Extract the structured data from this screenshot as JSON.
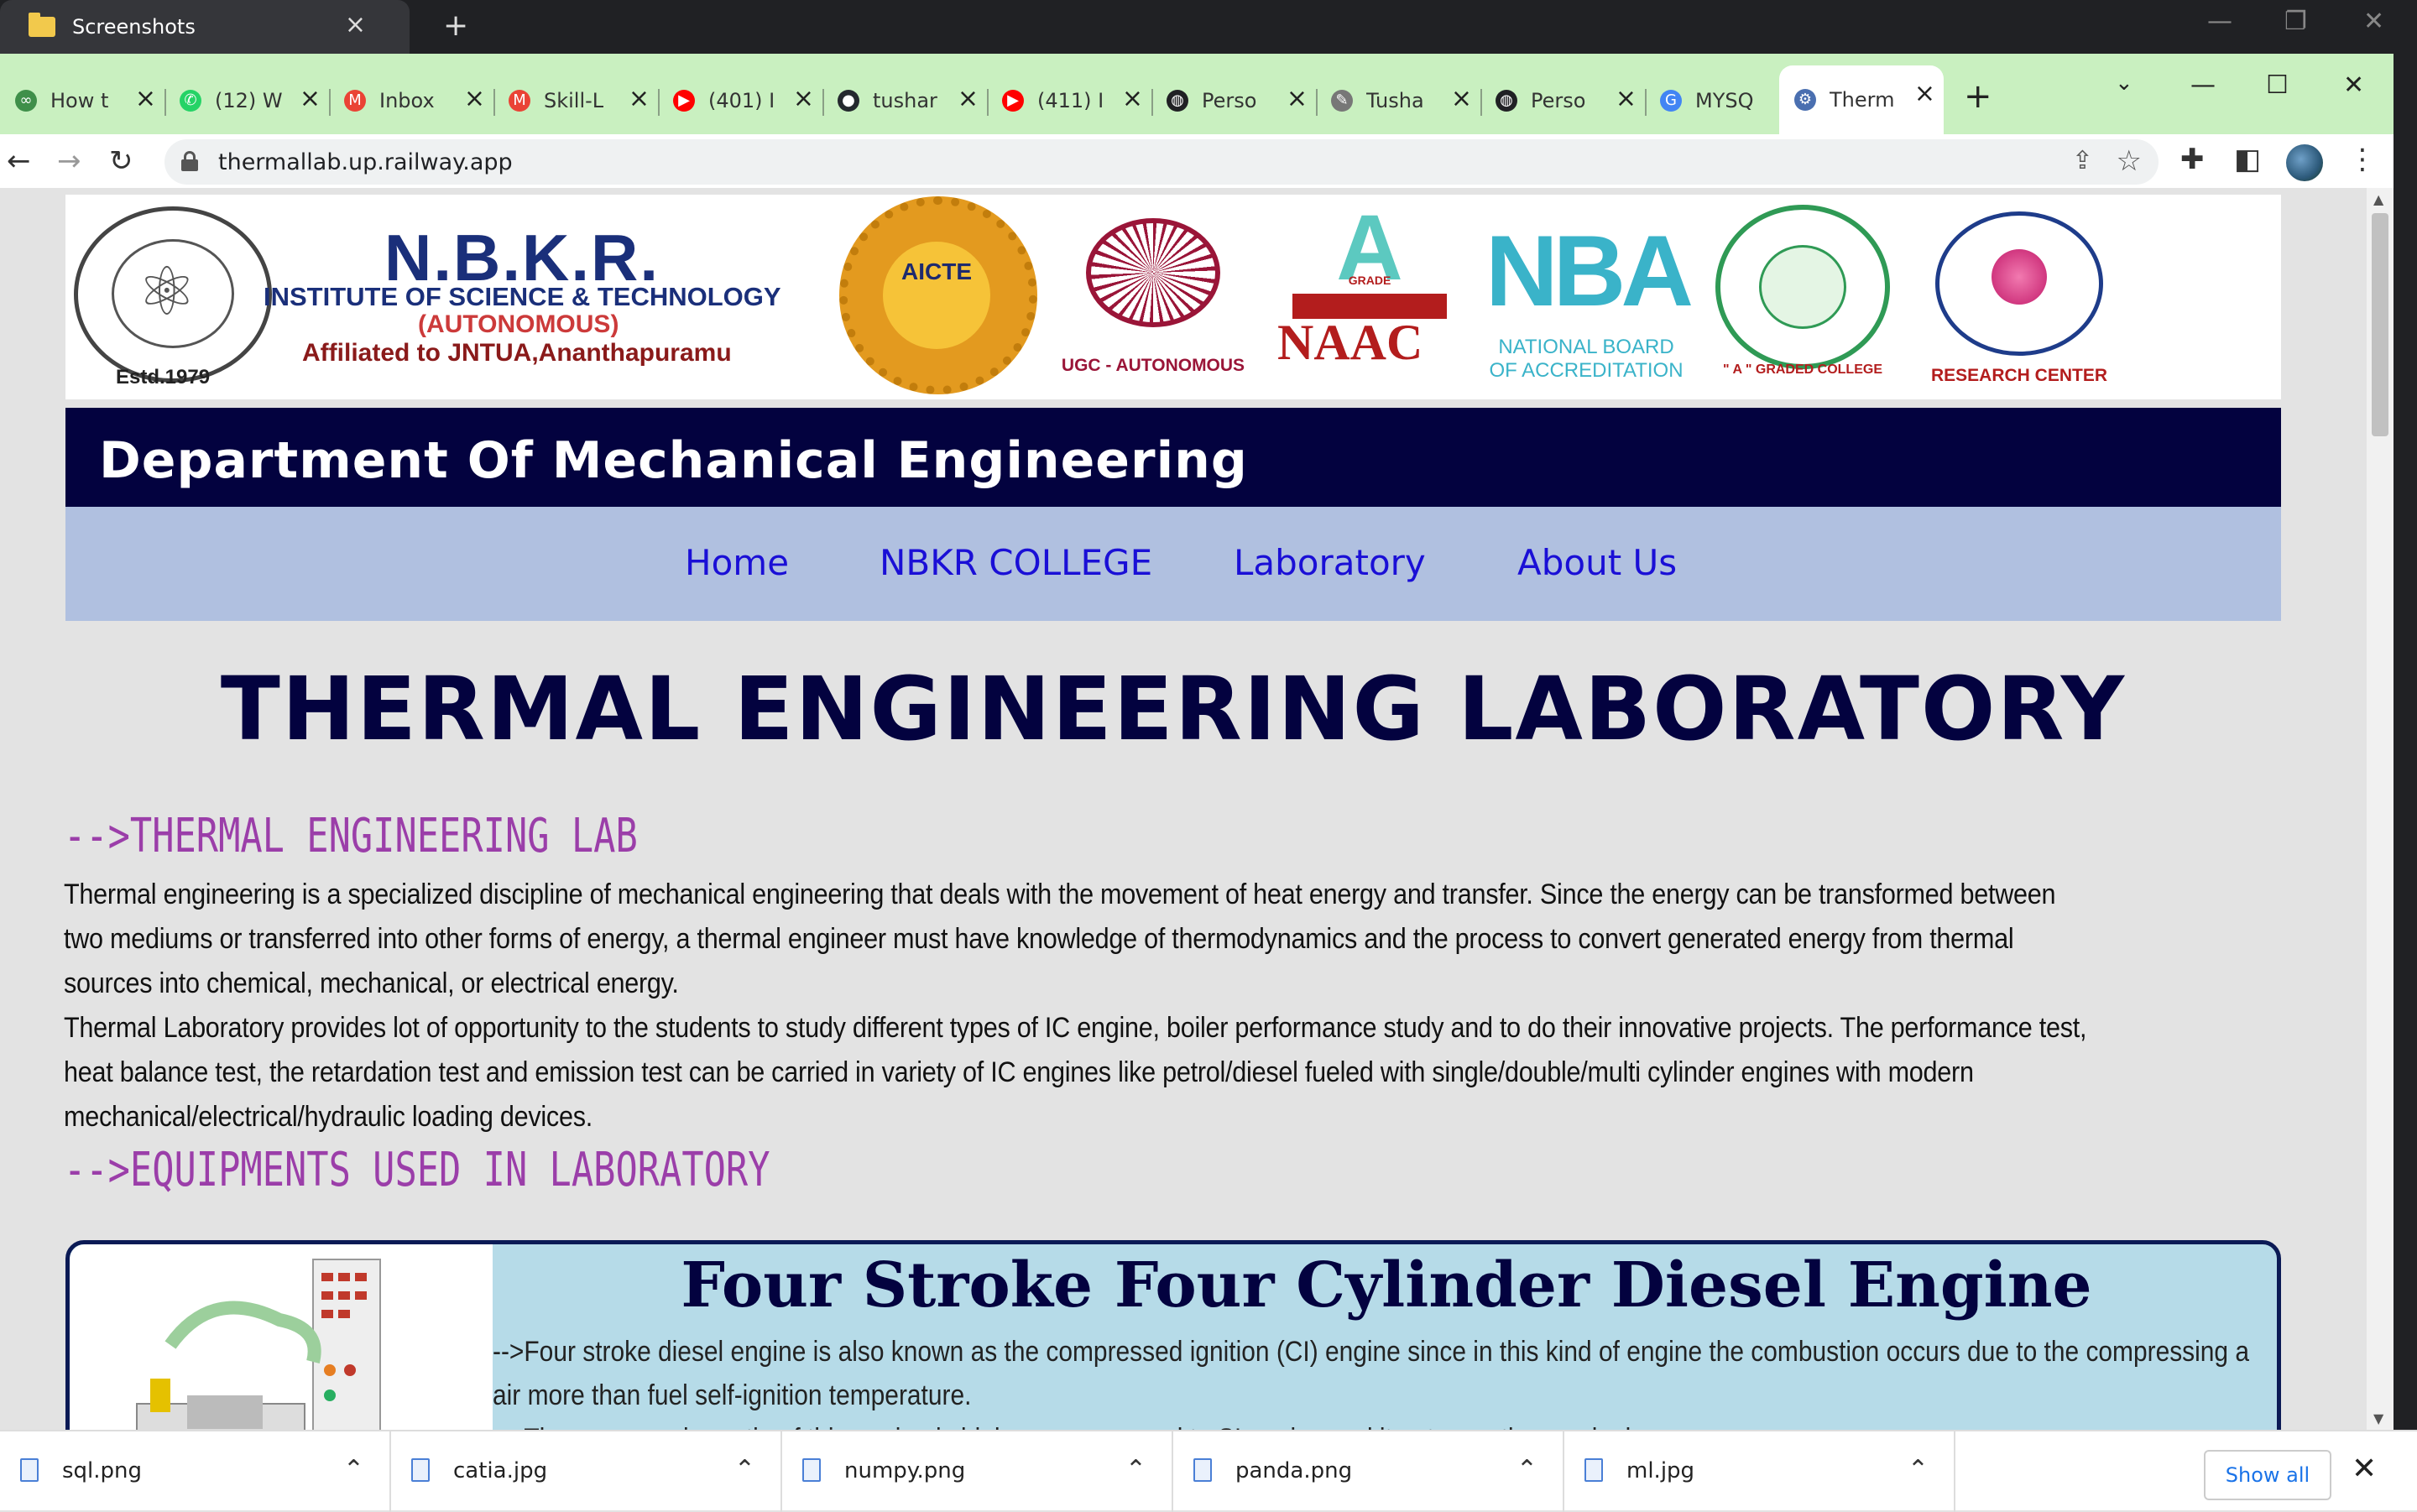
{
  "window": {
    "outer_tab_title": "Screenshots",
    "outer_new_tab": "+",
    "controls": {
      "minimize": "—",
      "restore": "❐",
      "close": "✕"
    }
  },
  "browser": {
    "tabs": [
      {
        "title": "How t",
        "icon": "link-icon",
        "color": "#3f8f4a"
      },
      {
        "title": "(12) W",
        "icon": "whatsapp-icon",
        "color": "#25d366"
      },
      {
        "title": "Inbox",
        "icon": "gmail-icon",
        "color": "#ea4335"
      },
      {
        "title": "Skill-L",
        "icon": "gmail-icon",
        "color": "#ea4335"
      },
      {
        "title": "(401) I",
        "icon": "youtube-icon",
        "color": "#ff0000"
      },
      {
        "title": "tushar",
        "icon": "github-icon",
        "color": "#24292e"
      },
      {
        "title": "(411) I",
        "icon": "youtube-icon",
        "color": "#ff0000"
      },
      {
        "title": "Perso",
        "icon": "globe-icon",
        "color": "#202124"
      },
      {
        "title": "Tusha",
        "icon": "pen-icon",
        "color": "#777777"
      },
      {
        "title": "Perso",
        "icon": "globe-icon",
        "color": "#202124"
      },
      {
        "title": "MYSQ",
        "icon": "google-icon",
        "color": "#4285f4"
      },
      {
        "title": "Therm",
        "icon": "gear-icon",
        "color": "#4a6fb0",
        "active": true
      }
    ],
    "new_tab": "+",
    "url": "thermallab.up.railway.app"
  },
  "page": {
    "banner": {
      "college_name": "N.B.K.R.",
      "institute_line": "INSTITUTE OF SCIENCE & TECHNOLOGY",
      "autonomous_line": "(AUTONOMOUS)",
      "affiliated_line": "Affiliated to JNTUA,Ananthapuramu",
      "estd": "Estd.1979",
      "aicte_text": "AICTE",
      "ugc_text": "UGC - AUTONOMOUS",
      "naac_grade": "A",
      "naac_grade_label": "GRADE",
      "naac_text": "NAAC",
      "nba_text": "NBA",
      "nba_sub1": "NATIONAL BOARD",
      "nba_sub2": "OF ACCREDITATION",
      "ap_text": "\" A \" GRADED COLLEGE",
      "jntu_text": "RESEARCH CENTER"
    },
    "dept_title": "Department Of Mechanical Engineering",
    "nav": [
      {
        "label": "Home"
      },
      {
        "label": "NBKR COLLEGE"
      },
      {
        "label": "Laboratory"
      },
      {
        "label": "About Us"
      }
    ],
    "main_title": "THERMAL ENGINEERING LABORATORY",
    "section1_head": "-->THERMAL ENGINEERING LAB",
    "para1": "Thermal engineering is a specialized discipline of mechanical engineering that deals with the movement of heat energy and transfer. Since the energy can be transformed between two mediums or transferred into other forms of energy, a thermal engineer must have knowledge of thermodynamics and the process to convert generated energy from thermal sources into chemical, mechanical, or electrical energy.",
    "para2": "Thermal Laboratory provides lot of opportunity to the students to study different types of IC engine, boiler performance study and to do their innovative projects. The performance test, heat balance test, the retardation test and emission test can be carried in variety of IC engines like petrol/diesel fueled with single/double/multi cylinder engines with modern mechanical/electrical/hydraulic loading devices.",
    "section2_head": "-->EQUIPMENTS USED IN LABORATORY",
    "equipment": {
      "title": "Four Stroke Four Cylinder Diesel Engine",
      "line1": "-->Four stroke diesel engine is also known as the compressed ignition (CI) engine since in this kind of engine the combustion occurs due to the compressing a air more than fuel self-ignition temperature.",
      "line2": "-->The compression ratio of this engine is higher as compared to SI engine and it not uses the spark plug."
    }
  },
  "downloads": {
    "items": [
      {
        "name": "sql.png"
      },
      {
        "name": "catia.jpg"
      },
      {
        "name": "numpy.png"
      },
      {
        "name": "panda.png"
      },
      {
        "name": "ml.jpg"
      }
    ],
    "show_all": "Show all"
  }
}
